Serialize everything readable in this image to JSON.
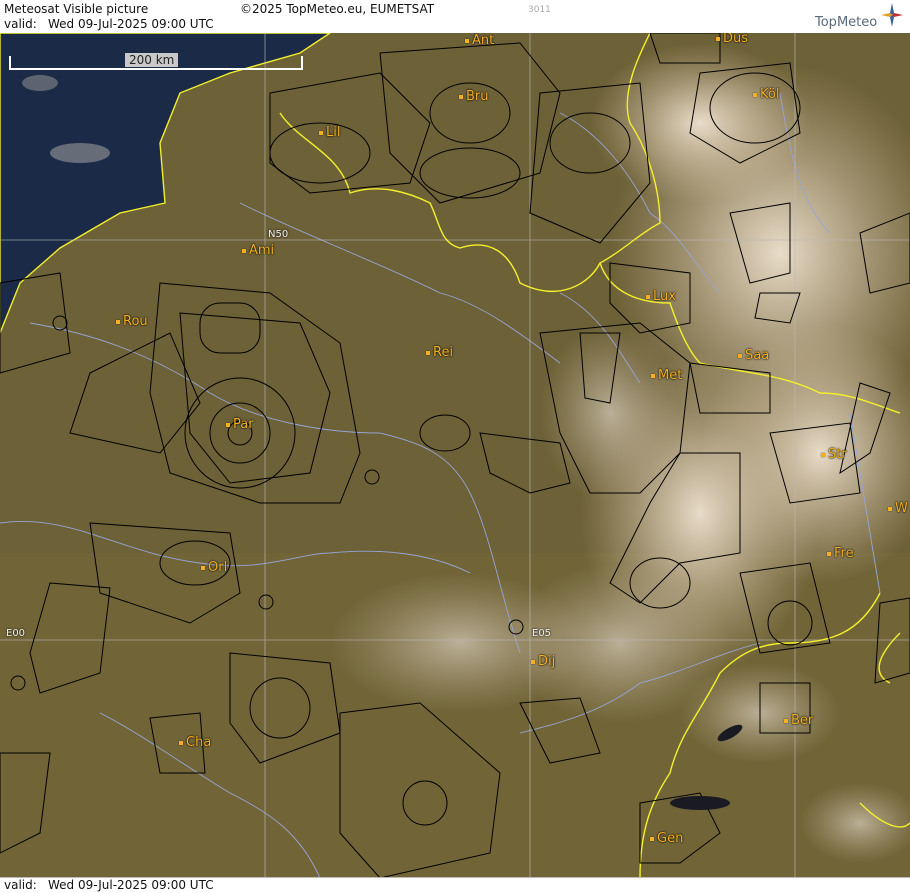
{
  "header": {
    "title": "Meteosat Visible picture",
    "valid_label": "valid:",
    "valid_time": "Wed  09-Jul-2025  09:00 UTC",
    "copyright": "©2025 TopMeteo.eu, EUMETSAT",
    "code": "3011",
    "brand": "TopMeteo"
  },
  "footer": {
    "valid_label": "valid:",
    "valid_time": "Wed  09-Jul-2025  09:00 UTC"
  },
  "map": {
    "scale_label": "200 km",
    "grid_labels": {
      "n50": "N50",
      "e00": "E00",
      "e05": "E05"
    },
    "cities": [
      {
        "name": "Ant"
      },
      {
        "name": "Bru"
      },
      {
        "name": "Dus"
      },
      {
        "name": "Köl"
      },
      {
        "name": "Lil"
      },
      {
        "name": "Ami"
      },
      {
        "name": "Rou"
      },
      {
        "name": "Rei"
      },
      {
        "name": "Lux"
      },
      {
        "name": "Saa"
      },
      {
        "name": "Met"
      },
      {
        "name": "Par"
      },
      {
        "name": "Str"
      },
      {
        "name": "Orl"
      },
      {
        "name": "Fre"
      },
      {
        "name": "W"
      },
      {
        "name": "Dij"
      },
      {
        "name": "Ber"
      },
      {
        "name": "Cha"
      },
      {
        "name": "Gen"
      }
    ],
    "colors": {
      "land": "#6e6238",
      "sea": "#1c2b48",
      "cloud": "#e2d2bc",
      "border": "#f3ef2a",
      "airspace": "#000000",
      "rivers": "#9aa6d8",
      "city": "#f4b020"
    }
  }
}
